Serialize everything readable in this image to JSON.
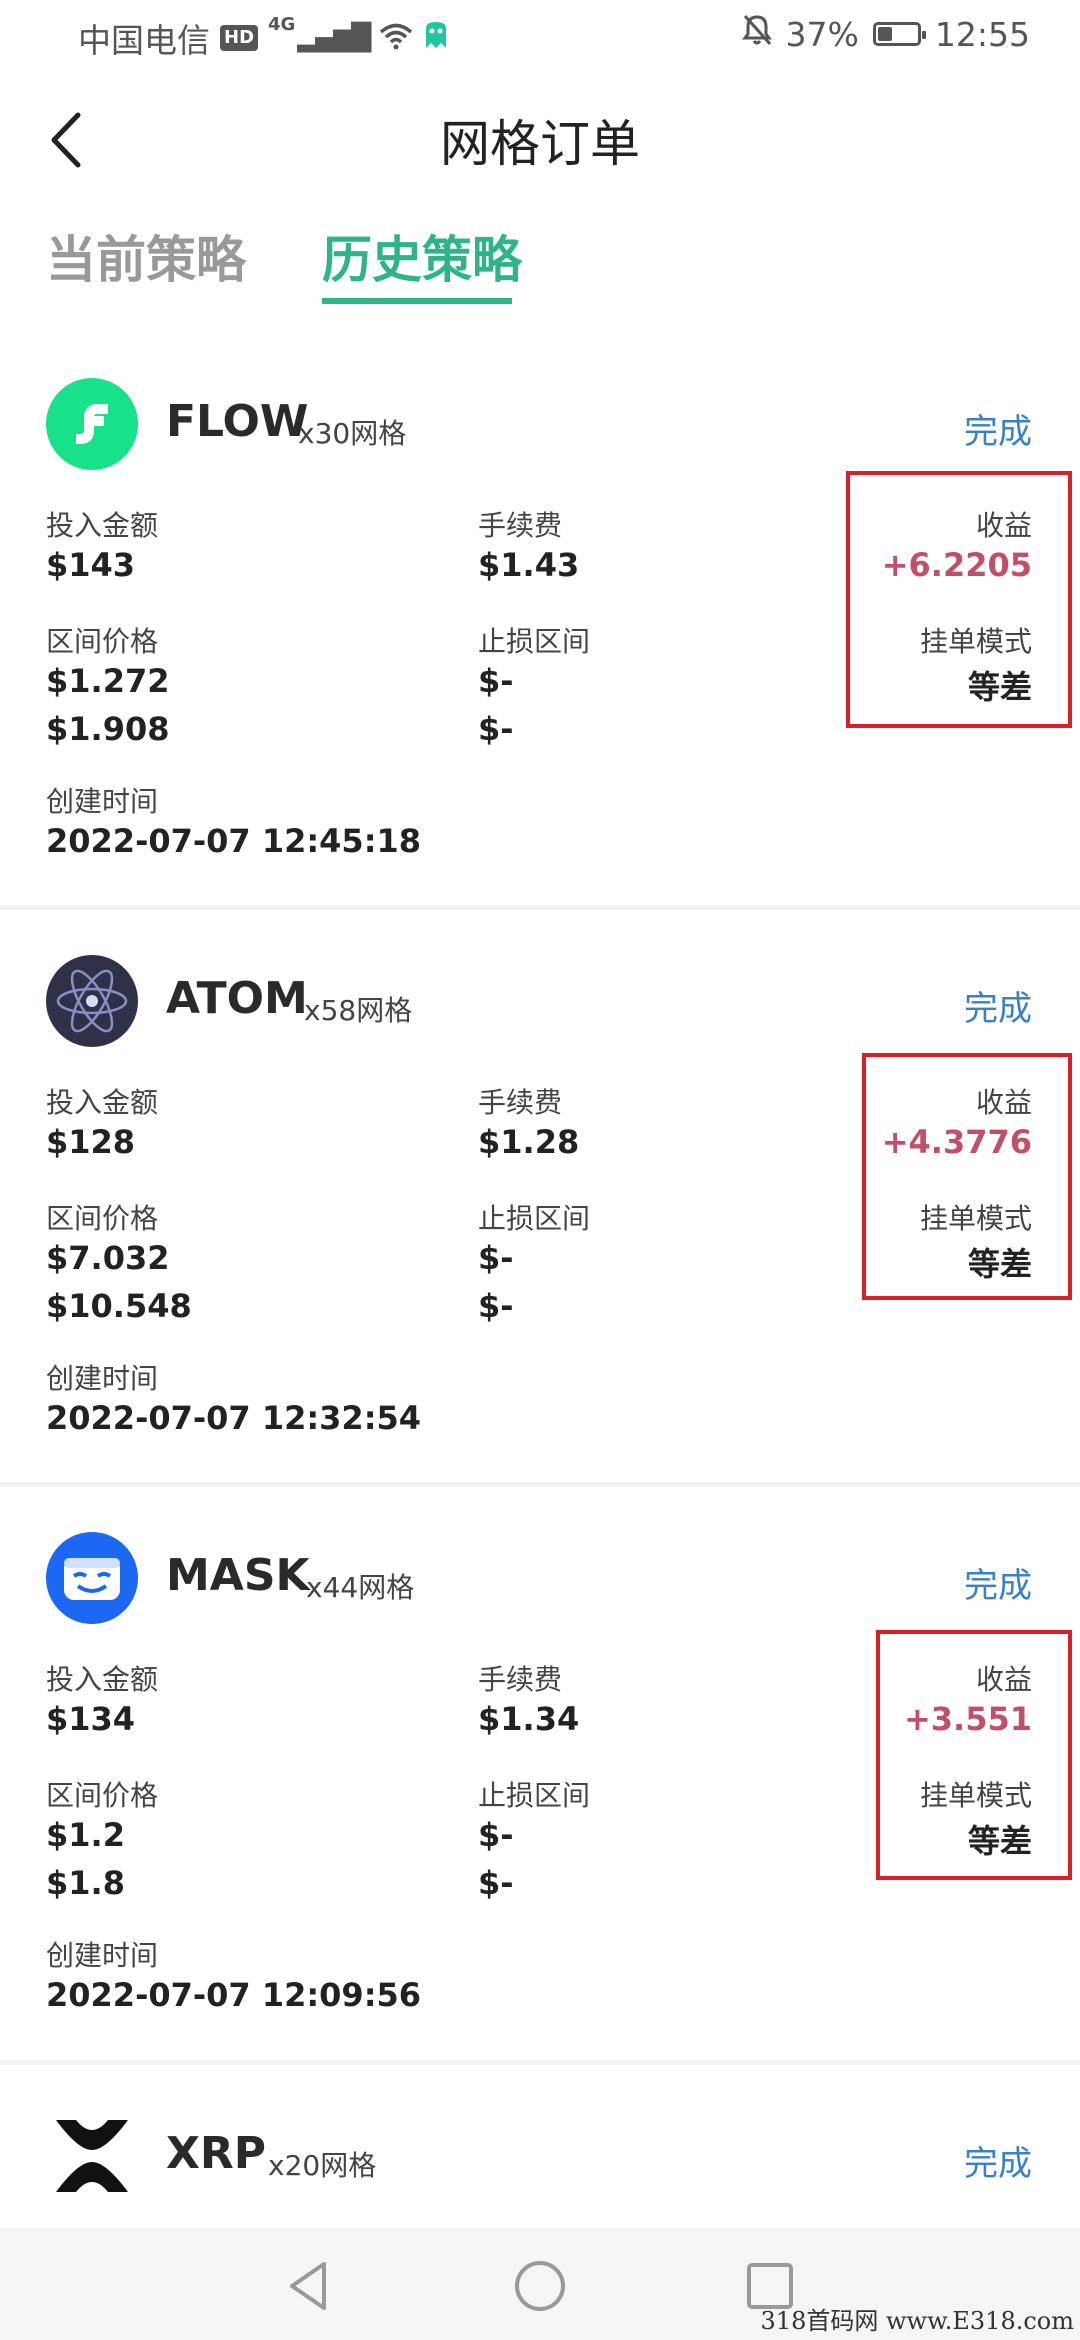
{
  "status_bar": {
    "carrier": "中国电信",
    "hd": "HD",
    "network": "4G",
    "battery_level": "37%",
    "battery_fraction": 0.37,
    "time": "12:55"
  },
  "header": {
    "title": "网格订单"
  },
  "tabs": [
    {
      "label": "当前策略",
      "active": false
    },
    {
      "label": "历史策略",
      "active": true
    }
  ],
  "labels": {
    "invest": "投入金额",
    "fee": "手续费",
    "profit": "收益",
    "range": "区间价格",
    "stop": "止损区间",
    "order_mode": "挂单模式",
    "created": "创建时间"
  },
  "cards": [
    {
      "coin": "FLOW",
      "grid": "x30网格",
      "status": "完成",
      "invest": "$143",
      "fee": "$1.43",
      "profit": "+6.2205",
      "range_low": "$1.272",
      "range_high": "$1.908",
      "stop_low": "$-",
      "stop_high": "$-",
      "mode": "等差",
      "created": "2022-07-07 12:45:18",
      "logo_icon": "flow-logo-icon",
      "logo_color": "#17e28a"
    },
    {
      "coin": "ATOM",
      "grid": "x58网格",
      "status": "完成",
      "invest": "$128",
      "fee": "$1.28",
      "profit": "+4.3776",
      "range_low": "$7.032",
      "range_high": "$10.548",
      "stop_low": "$-",
      "stop_high": "$-",
      "mode": "等差",
      "created": "2022-07-07 12:32:54",
      "logo_icon": "atom-logo-icon",
      "logo_color": "#2e3148"
    },
    {
      "coin": "MASK",
      "grid": "x44网格",
      "status": "完成",
      "invest": "$134",
      "fee": "$1.34",
      "profit": "+3.551",
      "range_low": "$1.2",
      "range_high": "$1.8",
      "stop_low": "$-",
      "stop_high": "$-",
      "mode": "等差",
      "created": "2022-07-07 12:09:56",
      "logo_icon": "mask-logo-icon",
      "logo_color": "#1c68f3"
    },
    {
      "coin": "XRP",
      "grid": "x20网格",
      "status": "完成",
      "logo_icon": "xrp-logo-icon",
      "logo_color": "#111111"
    }
  ],
  "colors": {
    "accent": "#2fb48a",
    "profit": "#c0506a",
    "link": "#3a80c4",
    "highlight": "#d8202a"
  },
  "watermark": "318首码网 www.E318.com"
}
